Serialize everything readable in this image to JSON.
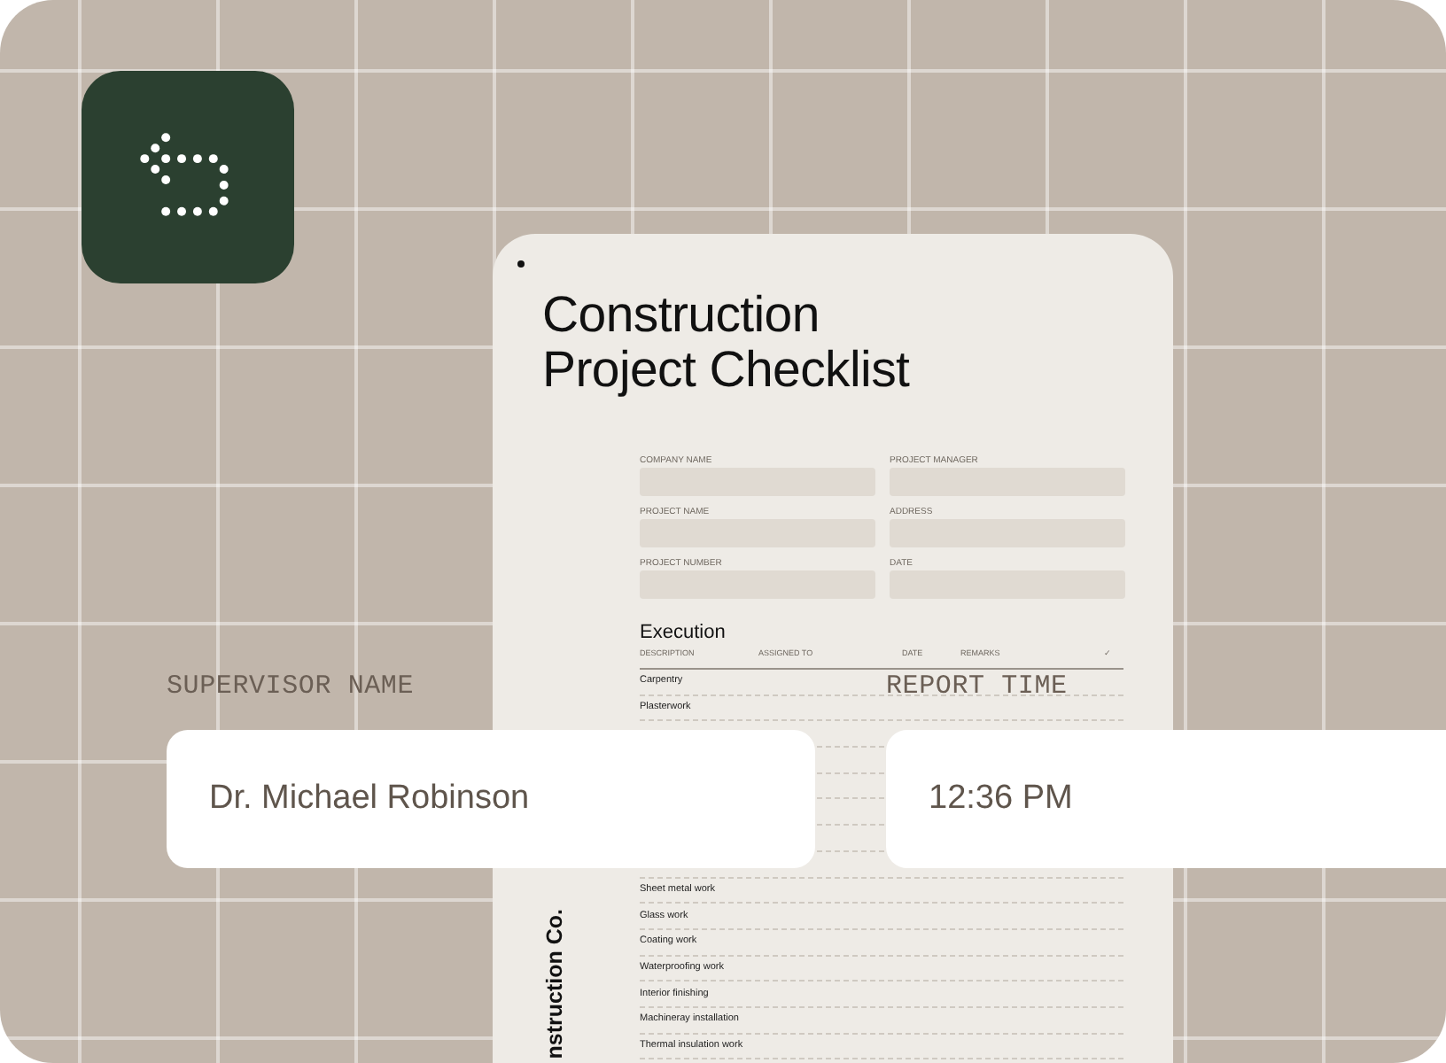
{
  "document": {
    "title_lines": [
      "Construction",
      "Project Checklist"
    ],
    "form_fields": [
      {
        "label": "COMPANY NAME"
      },
      {
        "label": "PROJECT MANAGER"
      },
      {
        "label": "PROJECT NAME"
      },
      {
        "label": "ADDRESS"
      },
      {
        "label": "PROJECT NUMBER"
      },
      {
        "label": "DATE"
      }
    ],
    "section": {
      "title": "Execution",
      "columns": [
        "DESCRIPTION",
        "ASSIGNED TO",
        "DATE",
        "REMARKS",
        "✓"
      ],
      "rows_top": [
        "Carpentry",
        "Plasterwork"
      ],
      "rows_bottom": [
        "Sheet metal work",
        "Glass work",
        "Coating work",
        "Waterproofing work",
        "Interior finishing",
        "Machineray installation",
        "Thermal insulation work"
      ]
    },
    "side_text": "nstruction Co."
  },
  "fields": [
    {
      "label": "SUPERVISOR NAME",
      "value": "Dr. Michael Robinson"
    },
    {
      "label": "REPORT TIME",
      "value": "12:36 PM"
    }
  ]
}
